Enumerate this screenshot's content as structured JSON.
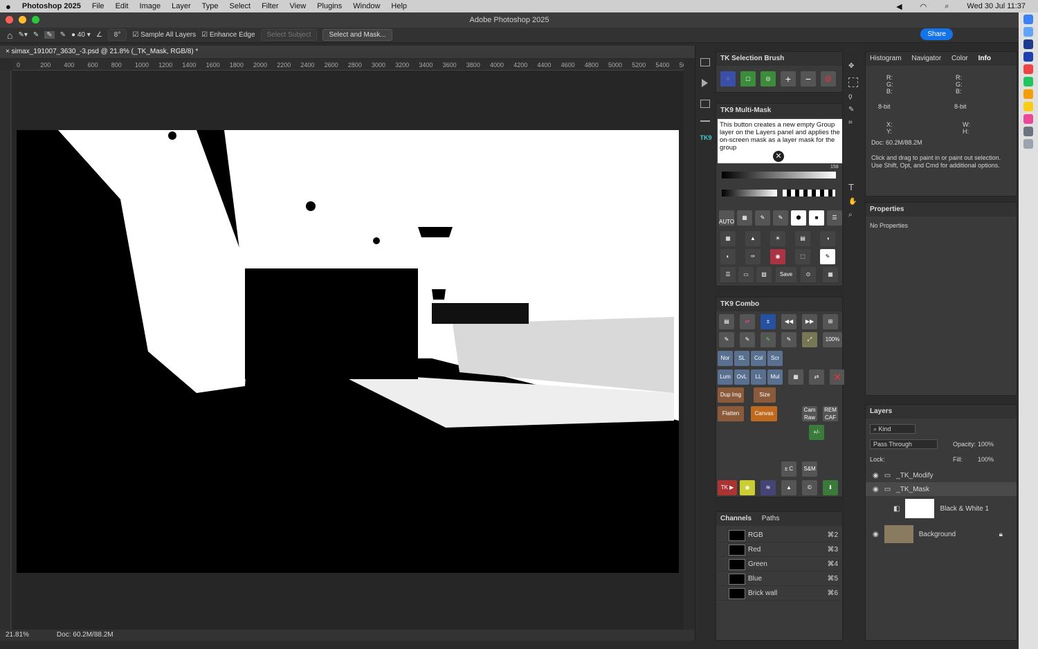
{
  "menubar": {
    "app": "Photoshop 2025",
    "items": [
      "File",
      "Edit",
      "Image",
      "Layer",
      "Type",
      "Select",
      "Filter",
      "View",
      "Plugins",
      "Window",
      "Help"
    ],
    "clock": "Wed 30 Jul  11:37"
  },
  "window": {
    "title": "Adobe Photoshop 2025"
  },
  "options": {
    "brush_size": "40",
    "angle": "8°",
    "sample_all_layers": "Sample All Layers",
    "enhance_edge": "Enhance Edge",
    "select_subject": "Select Subject",
    "select_and_mask": "Select and Mask...",
    "share": "Share"
  },
  "document": {
    "tab": "simax_191007_3630_-3.psd @ 21.8% (_TK_Mask, RGB/8) *",
    "zoom": "21.81%",
    "doc_size": "Doc: 60.2M/88.2M"
  },
  "ruler": [
    "0",
    "200",
    "400",
    "600",
    "800",
    "1000",
    "1200",
    "1400",
    "1600",
    "1800",
    "2000",
    "2200",
    "2400",
    "2600",
    "2800",
    "3000",
    "3200",
    "3400",
    "3600",
    "3800",
    "4000",
    "4200",
    "4400",
    "4600",
    "4800",
    "5000",
    "5200",
    "5400",
    "56"
  ],
  "tk_selection": {
    "title": "TK Selection Brush"
  },
  "tk_multimask": {
    "title": "TK9 Multi-Mask",
    "tooltip": "This button creates a new empty Group layer on the Layers panel and applies the on-screen mask as a layer mask for the group",
    "slider_value": "158",
    "auto": "AUTO",
    "save": "Save"
  },
  "tk_combo": {
    "title": "TK9 Combo",
    "labels": [
      "100%",
      "Nor",
      "SL",
      "Col",
      "Scr",
      "Lum",
      "OvL",
      "LL",
      "Mul",
      "Dup Img",
      "Size",
      "Flatten",
      "Canvas",
      "Cam Raw",
      "REM CAF",
      "+/-",
      "± C",
      "S&M",
      "TK ▶"
    ]
  },
  "channels": {
    "tabs": [
      "Channels",
      "Paths"
    ],
    "rows": [
      {
        "name": "RGB",
        "key": "⌘2"
      },
      {
        "name": "Red",
        "key": "⌘3"
      },
      {
        "name": "Green",
        "key": "⌘4"
      },
      {
        "name": "Blue",
        "key": "⌘5"
      },
      {
        "name": "Brick wall",
        "key": "⌘6"
      }
    ]
  },
  "info": {
    "tabs": [
      "Histogram",
      "Navigator",
      "Color",
      "Info"
    ],
    "rgb": "R:\nG:\nB:",
    "bit": "8-bit",
    "xy": "X:\nY:",
    "wh": "W:\nH:",
    "doc": "Doc: 60.2M/88.2M",
    "hint": "Click and drag to paint in or paint out selection.  Use Shift, Opt, and Cmd for additional options."
  },
  "properties": {
    "title": "Properties",
    "text": "No Properties"
  },
  "layers": {
    "title": "Layers",
    "kind": "Kind",
    "blend": "Pass Through",
    "opacity_label": "Opacity:",
    "opacity": "100%",
    "lock": "Lock:",
    "fill_label": "Fill:",
    "fill": "100%",
    "rows": [
      "_TK_Modify",
      "_TK_Mask",
      "Black & White 1",
      "Background"
    ]
  },
  "colors": {
    "accent": "#1473e6"
  }
}
